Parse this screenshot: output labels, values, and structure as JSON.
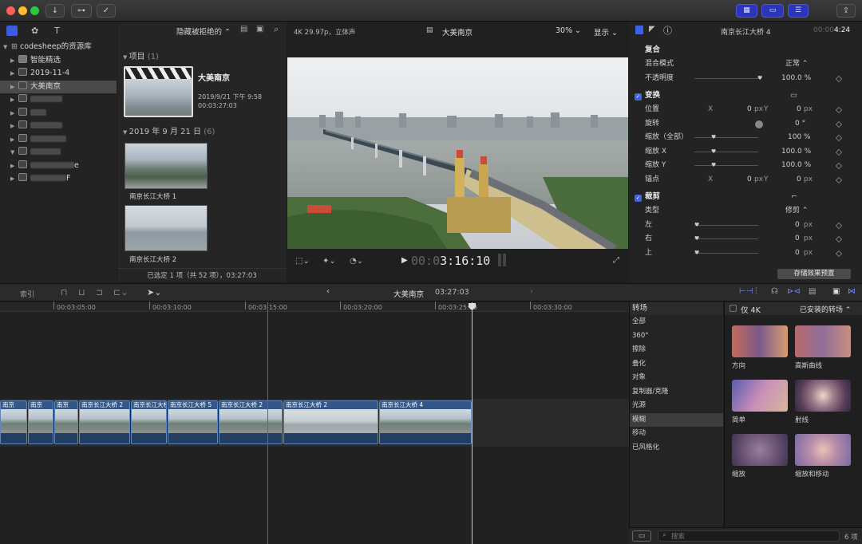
{
  "sidebar": {
    "library": "codesheep的资源库",
    "items": [
      {
        "label": "智能精选"
      },
      {
        "label": "2019-11-4"
      },
      {
        "label": "大美南京"
      },
      {
        "label": ""
      },
      {
        "label": ""
      },
      {
        "label": ""
      },
      {
        "label": ""
      },
      {
        "label": ""
      },
      {
        "label": "e"
      },
      {
        "label": "F"
      }
    ]
  },
  "browser": {
    "filter": "隐藏被拒绝的 ⌃",
    "group1_title": "项目",
    "group1_count": "(1)",
    "project": {
      "title": "大美南京",
      "date": "2019/9/21 下午 9:58",
      "duration": "00:03:27:03"
    },
    "group2_title": "2019 年 9 月 21 日",
    "group2_count": "(6)",
    "clips": [
      {
        "label": "南京长江大桥 1"
      },
      {
        "label": "南京长江大桥 2"
      }
    ],
    "status": "已选定 1 项（共 52 项），03:27:03"
  },
  "viewer": {
    "format": "4K 29.97p，立体声",
    "title": "大美南京",
    "zoom": "30% ⌄",
    "display": "显示 ⌄",
    "timecode_dim": "00:0",
    "timecode": "3:16:10"
  },
  "inspector": {
    "clip_title": "南京长江大桥 4",
    "duration_dim": "00:00",
    "duration": "4:24",
    "composite": "复合",
    "blend_mode_label": "混合模式",
    "blend_mode": "正常 ⌃",
    "opacity_label": "不透明度",
    "opacity": "100.0 %",
    "transform": "变换",
    "position_label": "位置",
    "position_x": "0",
    "position_y": "0",
    "rotation_label": "旋转",
    "rotation": "0 °",
    "scale_all_label": "缩放（全部）",
    "scale_all": "100 %",
    "scale_x_label": "缩放 X",
    "scale_x": "100.0 %",
    "scale_y_label": "缩放 Y",
    "scale_y": "100.0 %",
    "anchor_label": "锚点",
    "anchor_x": "0",
    "anchor_y": "0",
    "crop": "裁剪",
    "crop_type_label": "类型",
    "crop_type": "修剪 ⌃",
    "crop_left_label": "左",
    "crop_right_label": "右",
    "crop_top_label": "上",
    "crop_value": "0",
    "px": "px",
    "x": "X",
    "y": "Y",
    "save_preset": "存储效果预置"
  },
  "timeline": {
    "index": "索引",
    "project": "大美南京",
    "duration": "03:27:03",
    "ruler": [
      "00:03:05:00",
      "00:03:10:00",
      "00:03:15:00",
      "00:03:20:00",
      "00:03:25:00",
      "00:03:30:00"
    ],
    "clips": [
      {
        "label": "南京"
      },
      {
        "label": "南京"
      },
      {
        "label": "南京"
      },
      {
        "label": "南京长江大桥 2"
      },
      {
        "label": "南京长江大桥"
      },
      {
        "label": "南京长江大桥 5"
      },
      {
        "label": "南京长江大桥 2"
      },
      {
        "label": "南京长江大桥 2"
      },
      {
        "label": "南京长江大桥 4"
      }
    ]
  },
  "transitions": {
    "header": "转场",
    "only4k": "仅 4K",
    "installed": "已安装的转场 ⌃",
    "categories": [
      "全部",
      "360°",
      "擦除",
      "叠化",
      "对象",
      "复制器/克隆",
      "光源",
      "模糊",
      "移动",
      "已风格化"
    ],
    "items": [
      {
        "label": "方向"
      },
      {
        "label": "高斯曲线"
      },
      {
        "label": "简单"
      },
      {
        "label": "射线"
      },
      {
        "label": "缩放"
      },
      {
        "label": "缩放和移动"
      }
    ],
    "search_placeholder": "搜索",
    "count": "6 项"
  }
}
